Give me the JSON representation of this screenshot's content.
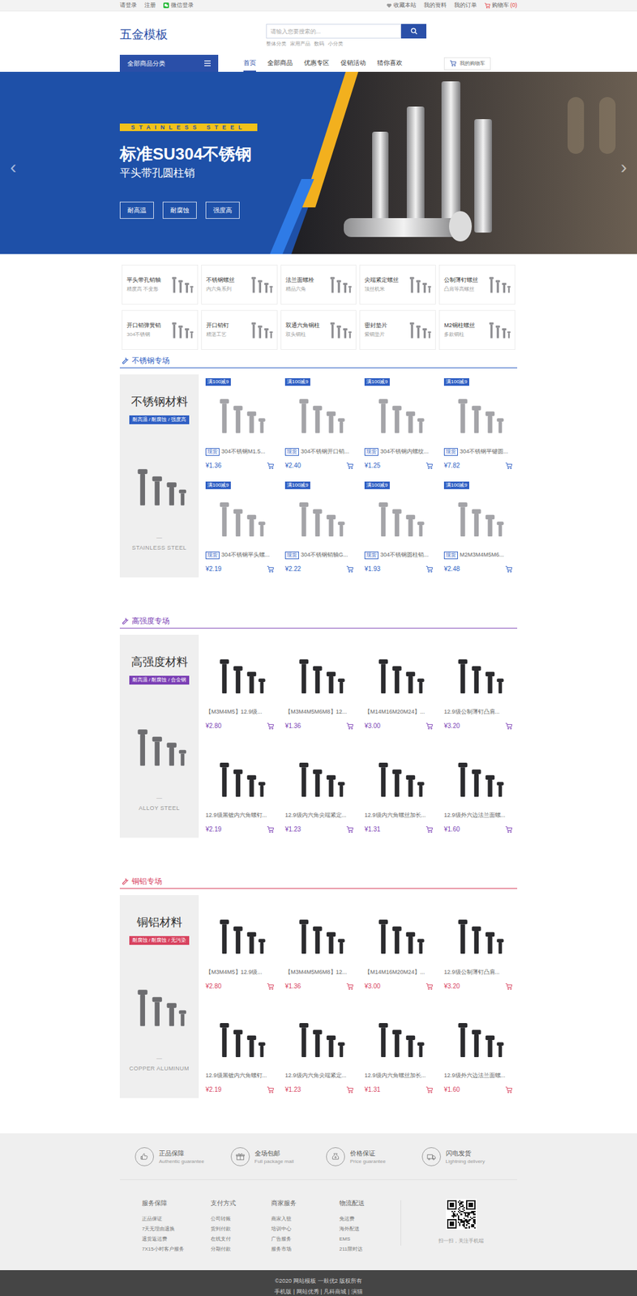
{
  "topbar": {
    "left": [
      "请登录",
      "注册",
      "微信登录"
    ],
    "right": [
      "收藏本站",
      "我的资料",
      "我的订单"
    ],
    "cart": {
      "label": "购物车",
      "count": "(0)"
    }
  },
  "header": {
    "logo": "五金模板",
    "search": {
      "placeholder": "请输入您要搜索的...",
      "hot": [
        "整体分类",
        "家用产品",
        "数码",
        "小分类"
      ]
    }
  },
  "nav": {
    "category": "全部商品分类",
    "items": [
      {
        "label": "首页",
        "selected": true
      },
      {
        "label": "全部商品",
        "selected": false
      },
      {
        "label": "优惠专区",
        "selected": false
      },
      {
        "label": "促销活动",
        "selected": false
      },
      {
        "label": "猜你喜欢",
        "selected": false
      }
    ],
    "cart": "我的购物车"
  },
  "banner": {
    "tag": "STAINLESS STEEL",
    "title": "标准SU304不锈钢",
    "subtitle": "平头带孔圆柱销",
    "features": [
      "耐高温",
      "耐腐蚀",
      "强度高"
    ],
    "prev": "‹",
    "next": "›"
  },
  "categories": [
    {
      "name": "平头带孔销轴",
      "sub": "精度高 不变形"
    },
    {
      "name": "不锈钢螺丝",
      "sub": "内六角系列"
    },
    {
      "name": "法兰面螺栓",
      "sub": "精品六角"
    },
    {
      "name": "尖端紧定螺丝",
      "sub": "顶丝机米"
    },
    {
      "name": "公制薄钉螺丝",
      "sub": "凸肩等高螺丝"
    },
    {
      "name": "开口销弹簧销",
      "sub": "304不锈钢"
    },
    {
      "name": "开口销钉",
      "sub": "精湛工艺"
    },
    {
      "name": "双通六角铜柱",
      "sub": "双头铜柱"
    },
    {
      "name": "密封垫片",
      "sub": "紫铜垫片"
    },
    {
      "name": "M2铜柱螺丝",
      "sub": "多款铜柱"
    }
  ],
  "sections": [
    {
      "heading": "不锈钢专场",
      "color": "#2f5fc4",
      "panel": {
        "title": "不锈钢材料",
        "badge": "耐高温 / 耐腐蚀 / 强度高",
        "dash": "—",
        "caption": "STAINLESS STEEL"
      },
      "products": [
        {
          "badge": "满100减9",
          "tag": "现货",
          "title": "304不锈钢M1.5...",
          "price": "¥1.36"
        },
        {
          "badge": "满100减9",
          "tag": "现货",
          "title": "304不锈钢开口销...",
          "price": "¥2.40"
        },
        {
          "badge": "满100减9",
          "tag": "现货",
          "title": "304不锈钢内螺纹...",
          "price": "¥1.25"
        },
        {
          "badge": "满100减9",
          "tag": "现货",
          "title": "304不锈钢平键圆...",
          "price": "¥7.82"
        },
        {
          "badge": "满100减9",
          "tag": "现货",
          "title": "304不锈钢平头螺...",
          "price": "¥2.19"
        },
        {
          "badge": "满100减9",
          "tag": "现货",
          "title": "304不锈钢销轴G...",
          "price": "¥2.22"
        },
        {
          "badge": "满100减9",
          "tag": "现货",
          "title": "304不锈钢圆柱销...",
          "price": "¥1.93"
        },
        {
          "badge": "满100减9",
          "tag": "现货",
          "title": "M2M3M4M5M6...",
          "price": "¥2.48"
        }
      ]
    },
    {
      "heading": "高强度专场",
      "color": "#7b3fb5",
      "panel": {
        "title": "高强度材料",
        "badge": "耐高温 / 耐腐蚀 / 合金钢",
        "dash": "—",
        "caption": "ALLOY STEEL"
      },
      "products": [
        {
          "title": "【M3M4M5】12.9级...",
          "price": "¥2.80"
        },
        {
          "title": "【M3M4M5M6M8】12...",
          "price": "¥1.36"
        },
        {
          "title": "【M14M16M20M24】...",
          "price": "¥3.00"
        },
        {
          "title": "12.9级公制薄钉凸肩...",
          "price": "¥3.20"
        },
        {
          "title": "12.9级黑镀内六角螺钉...",
          "price": "¥2.19"
        },
        {
          "title": "12.9级内六角尖端紧定...",
          "price": "¥1.23"
        },
        {
          "title": "12.9级内六角螺丝加长...",
          "price": "¥1.31"
        },
        {
          "title": "12.9级外六边法兰面螺...",
          "price": "¥1.60"
        }
      ]
    },
    {
      "heading": "铜铝专场",
      "color": "#d8435f",
      "panel": {
        "title": "铜铝材料",
        "badge": "耐腐蚀 / 耐腐蚀 / 无污染",
        "dash": "—",
        "caption": "COPPER ALUMINUM"
      },
      "products": [
        {
          "title": "【M3M4M5】12.9级...",
          "price": "¥2.80"
        },
        {
          "title": "【M3M4M5M6M8】12...",
          "price": "¥1.36"
        },
        {
          "title": "【M14M16M20M24】...",
          "price": "¥3.00"
        },
        {
          "title": "12.9级公制薄钉凸肩...",
          "price": "¥3.20"
        },
        {
          "title": "12.9级黑镀内六角螺钉...",
          "price": "¥2.19"
        },
        {
          "title": "12.9级内六角尖端紧定...",
          "price": "¥1.23"
        },
        {
          "title": "12.9级内六角螺丝加长...",
          "price": "¥1.31"
        },
        {
          "title": "12.9级外六边法兰面螺...",
          "price": "¥1.60"
        }
      ]
    }
  ],
  "footer": {
    "guarantees": [
      {
        "title": "正品保障",
        "sub": "Authentic guarantee"
      },
      {
        "title": "全场包邮",
        "sub": "Full package mail"
      },
      {
        "title": "价格保证",
        "sub": "Price guarantee"
      },
      {
        "title": "闪电发货",
        "sub": "Lightning delivery"
      }
    ],
    "columns": [
      {
        "title": "服务保障",
        "links": [
          "正品保证",
          "7天无理由退换",
          "退货返运费",
          "7X15小时客户服务"
        ]
      },
      {
        "title": "支付方式",
        "links": [
          "公司转账",
          "货到付款",
          "在线支付",
          "分期付款"
        ]
      },
      {
        "title": "商家服务",
        "links": [
          "商家入驻",
          "培训中心",
          "广告服务",
          "服务市场"
        ]
      },
      {
        "title": "物流配送",
        "links": [
          "免运费",
          "海外配送",
          "EMS",
          "211限时达"
        ]
      }
    ],
    "qr_caption": "扫一扫，关注手机端",
    "copyright": [
      "©2020 网站模板 一鼓优2 版权所有",
      "手机版 | 网站优秀 | 凡科商城 | 演猫"
    ]
  }
}
